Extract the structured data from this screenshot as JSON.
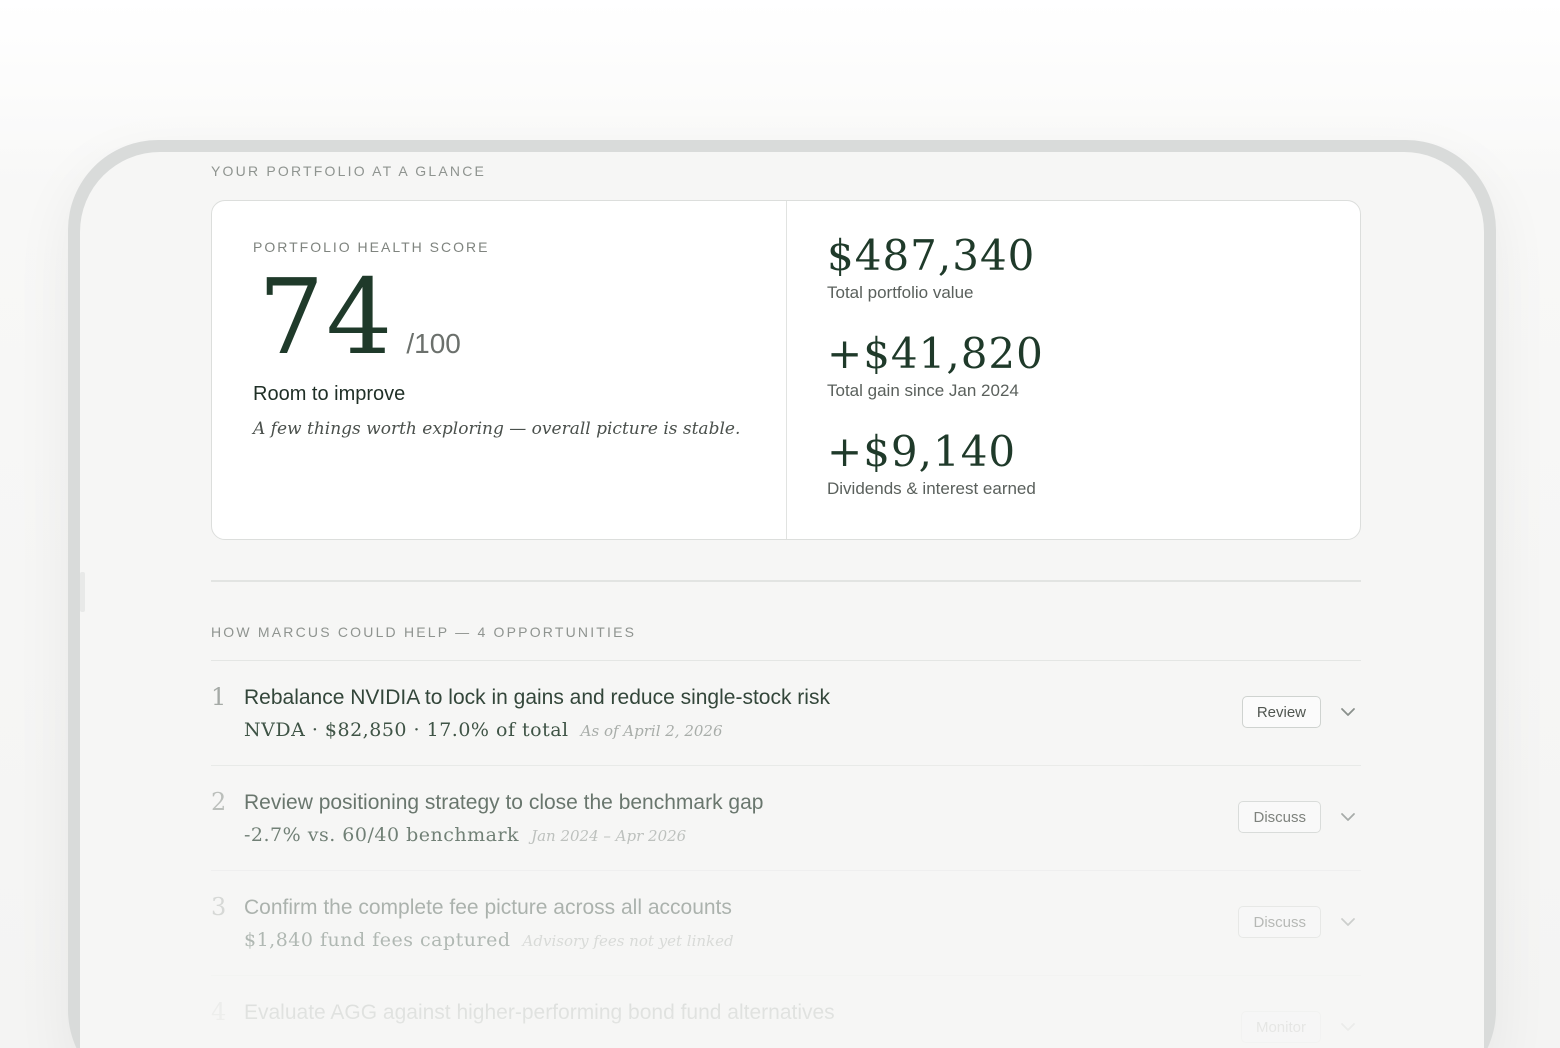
{
  "glance": {
    "eyebrow": "YOUR PORTFOLIO AT A GLANCE",
    "health": {
      "label": "PORTFOLIO HEALTH SCORE",
      "score": "74",
      "max": "/100",
      "status": "Room to improve",
      "note": "A few things worth exploring — overall picture is stable."
    },
    "stats": [
      {
        "value": "$487,340",
        "label": "Total portfolio value"
      },
      {
        "value": "+$41,820",
        "label": "Total gain since Jan 2024"
      },
      {
        "value": "+$9,140",
        "label": "Dividends & interest earned"
      }
    ]
  },
  "opportunities": {
    "eyebrow": "HOW MARCUS COULD HELP — 4 OPPORTUNITIES",
    "items": [
      {
        "num": "1",
        "title": "Rebalance NVIDIA to lock in gains and reduce single-stock risk",
        "detail": "NVDA · $82,850 · 17.0% of total",
        "note": "As of April 2, 2026",
        "action": "Review"
      },
      {
        "num": "2",
        "title": "Review positioning strategy to close the benchmark gap",
        "detail": "-2.7% vs. 60/40 benchmark",
        "note": "Jan 2024 – Apr 2026",
        "action": "Discuss"
      },
      {
        "num": "3",
        "title": "Confirm the complete fee picture across all accounts",
        "detail": "$1,840 fund fees captured",
        "note": "Advisory fees not yet linked",
        "action": "Discuss"
      },
      {
        "num": "4",
        "title": "Evaluate AGG against higher-performing bond fund alternatives",
        "detail": "",
        "note": "",
        "action": "Monitor"
      }
    ]
  },
  "icons": {
    "expand": "chevron-down-icon"
  },
  "colors": {
    "brand": "#1f3a2a",
    "accent_text": "#33463a",
    "border": "#dcdedc"
  }
}
